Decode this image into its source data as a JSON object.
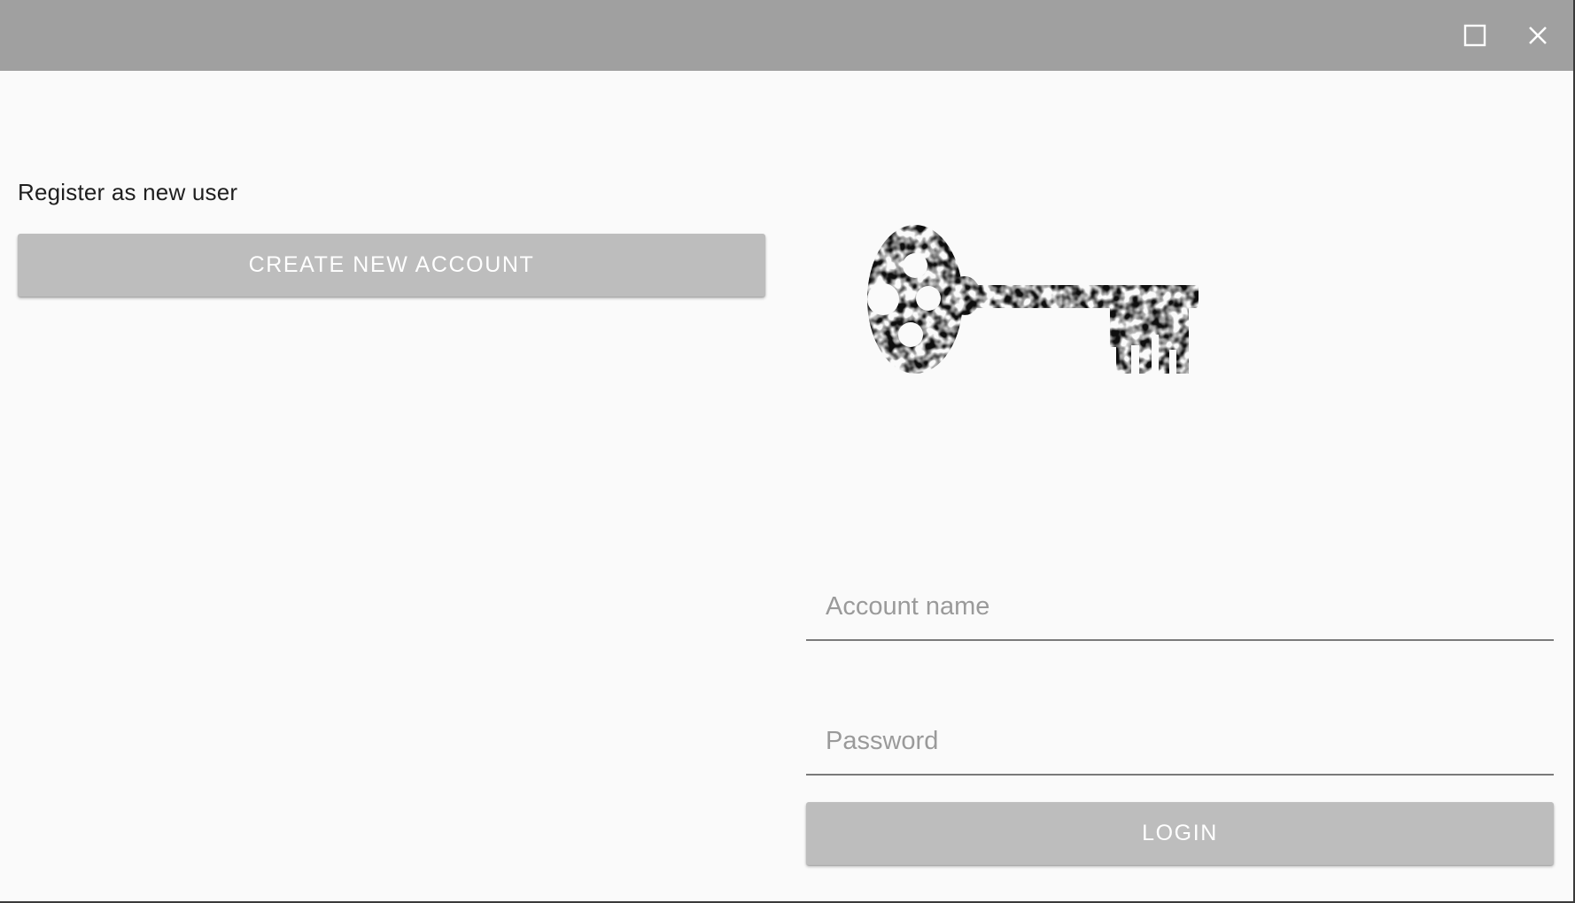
{
  "window": {
    "controls": {
      "maximize_icon": "maximize-icon",
      "close_icon": "close-icon"
    },
    "titlebar_color": "#a0a0a0",
    "background_color": "#fafafa"
  },
  "register": {
    "label": "Register as new user",
    "create_button_label": "CREATE NEW ACCOUNT"
  },
  "login": {
    "logo_icon": "skeleton-key-icon",
    "account_name_placeholder": "Account name",
    "account_name_value": "",
    "password_placeholder": "Password",
    "password_value": "",
    "login_button_label": "LOGIN"
  },
  "colors": {
    "button_bg": "#bdbdbd",
    "button_text": "#ffffff",
    "underline": "#7a7a7a"
  }
}
